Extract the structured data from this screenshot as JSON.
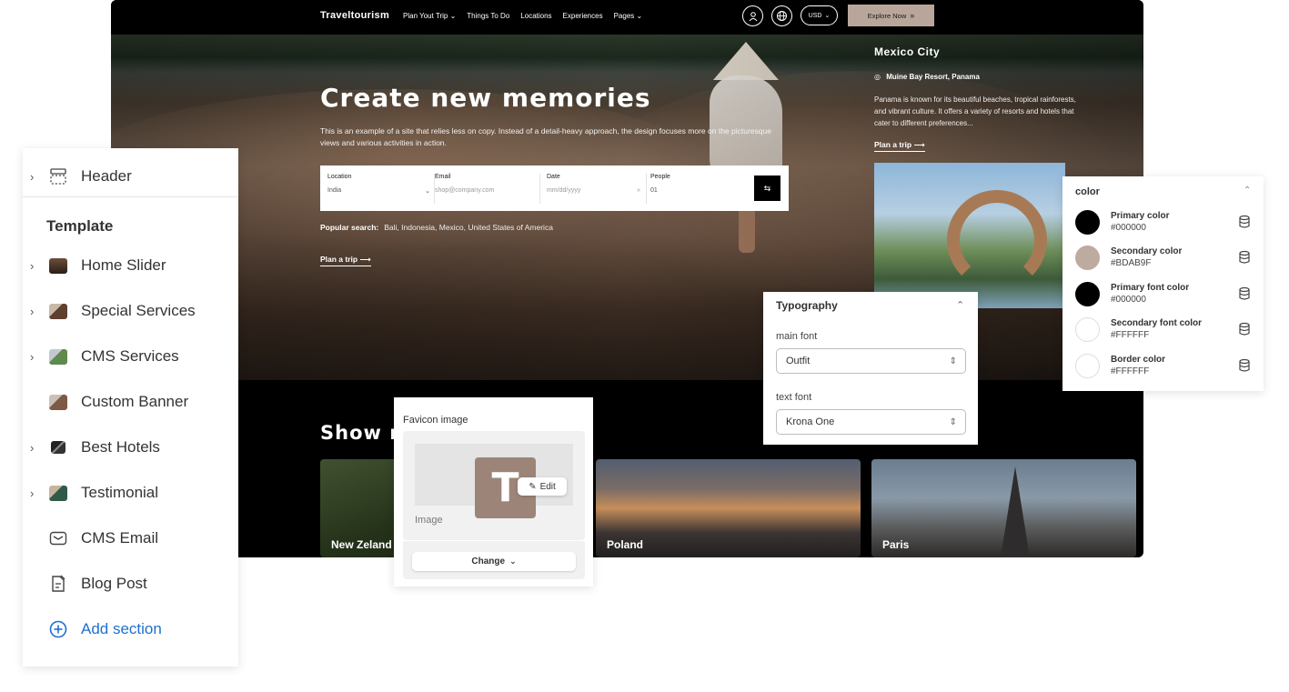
{
  "site": {
    "brand": "Traveltourism",
    "nav": [
      "Plan Yout Trip ⌄",
      "Things To Do",
      "Locations",
      "Experiences",
      "Pages ⌄"
    ],
    "currency": "USD",
    "explore_btn": "Explore Now",
    "hero": {
      "title": "Create new memories",
      "description": "This is an example of a site that relies less on copy. Instead of a detail-heavy approach, the design focuses more on the picturesque views and various activities in action.",
      "search": {
        "location_label": "Location",
        "location_value": "India",
        "email_label": "Email",
        "email_placeholder": "shop@company.com",
        "date_label": "Date",
        "date_placeholder": "mm/dd/yyyy",
        "people_label": "People",
        "people_value": "01"
      },
      "popular_label": "Popular search:",
      "popular_value": "Bali, Indonesia, Mexico, United States of America",
      "plan_link": "Plan a trip ⟶"
    },
    "feature": {
      "title": "Mexico City",
      "location": "Muine Bay Resort, Panama",
      "description": "Panama is known for its beautiful beaches, tropical rainforests, and vibrant culture. It offers a variety of resorts and hotels that cater to different preferences...",
      "plan_link": "Plan a trip ⟶"
    },
    "show_title": "Show m",
    "destinations": [
      "New Zeland",
      "Poland",
      "Paris"
    ]
  },
  "left_panel": {
    "header_label": "Header",
    "template_title": "Template",
    "sections": [
      {
        "label": "Home Slider",
        "has_chevron": true
      },
      {
        "label": "Special Services",
        "has_chevron": true
      },
      {
        "label": "CMS Services",
        "has_chevron": true
      },
      {
        "label": "Custom Banner",
        "has_chevron": false
      },
      {
        "label": "Best Hotels",
        "has_chevron": true
      },
      {
        "label": "Testimonial",
        "has_chevron": true
      },
      {
        "label": "CMS Email",
        "has_chevron": false
      },
      {
        "label": "Blog Post",
        "has_chevron": false
      }
    ],
    "add_section": "Add section"
  },
  "favicon_panel": {
    "title": "Favicon image",
    "letter": "T",
    "edit_label": "Edit",
    "image_label": "Image",
    "change_label": "Change"
  },
  "typography_panel": {
    "title": "Typography",
    "main_font_label": "main font",
    "main_font_value": "Outfit",
    "text_font_label": "text font",
    "text_font_value": "Krona One"
  },
  "color_panel": {
    "title": "color",
    "colors": [
      {
        "name": "Primary color",
        "value": "#000000"
      },
      {
        "name": "Secondary color",
        "value": "#BDAB9F"
      },
      {
        "name": "Primary font color",
        "value": "#000000"
      },
      {
        "name": "Secondary font color",
        "value": "#FFFFFF"
      },
      {
        "name": "Border color",
        "value": "#FFFFFF"
      }
    ]
  },
  "icons": [
    "user-icon",
    "globe-icon",
    "chevrons-right-icon",
    "location-pin-icon",
    "swap-icon",
    "pencil-icon",
    "chevron-down-icon",
    "chevron-up-icon",
    "database-icon",
    "plus-circle-icon",
    "mail-icon",
    "document-edit-icon",
    "header-layout-icon"
  ],
  "accent_colors": {
    "explore": "#b9a69b",
    "link_blue": "#1f6fd1",
    "favicon_bg": "#9c8578"
  }
}
